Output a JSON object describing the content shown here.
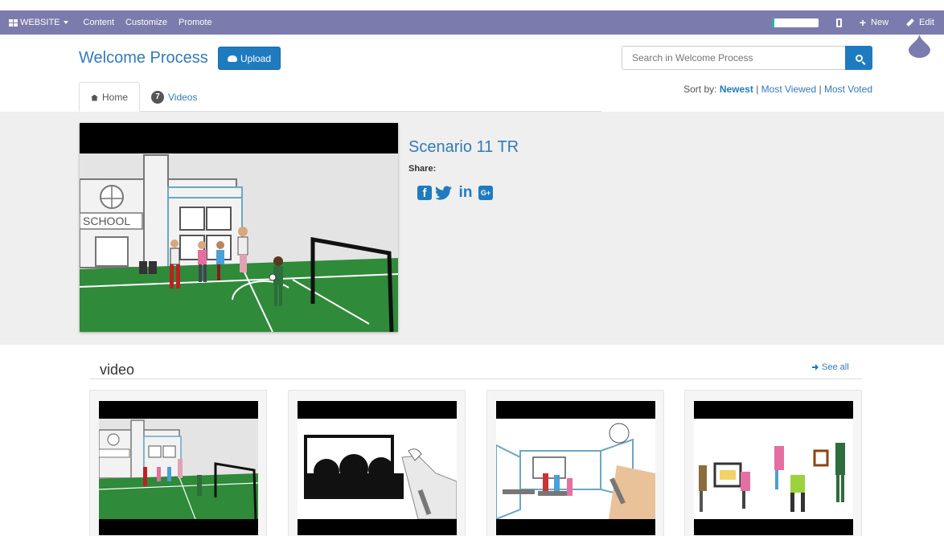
{
  "topbar": {
    "brand": "WEBSITE",
    "menu": [
      "Content",
      "Customize",
      "Promote"
    ],
    "progress_fraction": 0.05,
    "new_label": "New",
    "edit_label": "Edit"
  },
  "header": {
    "title": "Welcome Process",
    "upload_label": "Upload",
    "search_placeholder": "Search in Welcome Process"
  },
  "sort": {
    "label": "Sort by:",
    "options": [
      "Newest",
      "Most Viewed",
      "Most Voted"
    ],
    "active": "Newest"
  },
  "tabs": {
    "home": "Home",
    "videos_count": "7",
    "videos": "Videos"
  },
  "featured": {
    "title": "Scenario 11 TR",
    "share_label": "Share:",
    "school_sign": "SCHOOL",
    "share_icons": [
      "facebook-icon",
      "twitter-icon",
      "linkedin-icon",
      "google-plus-icon"
    ]
  },
  "section": {
    "title": "video",
    "see_all": "See all"
  },
  "colors": {
    "admin_bar": "#7c7bad",
    "primary": "#1f7bbf",
    "link": "#337ab7",
    "field_green": "#2f8a3a"
  }
}
